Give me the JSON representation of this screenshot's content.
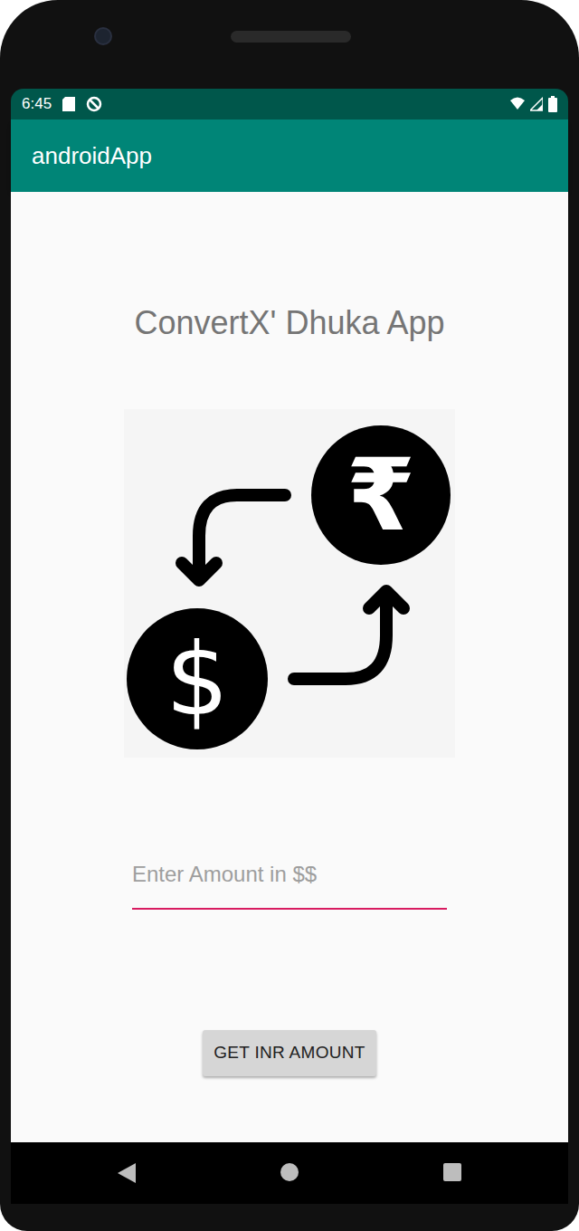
{
  "status_bar": {
    "time": "6:45"
  },
  "app_bar": {
    "title": "androidApp"
  },
  "heading": "ConvertX' Dhuka App",
  "illustration": {
    "symbols": [
      "₹",
      "$"
    ]
  },
  "input": {
    "placeholder": "Enter Amount in $$",
    "value": ""
  },
  "button": {
    "label": "GET INR AMOUNT"
  }
}
